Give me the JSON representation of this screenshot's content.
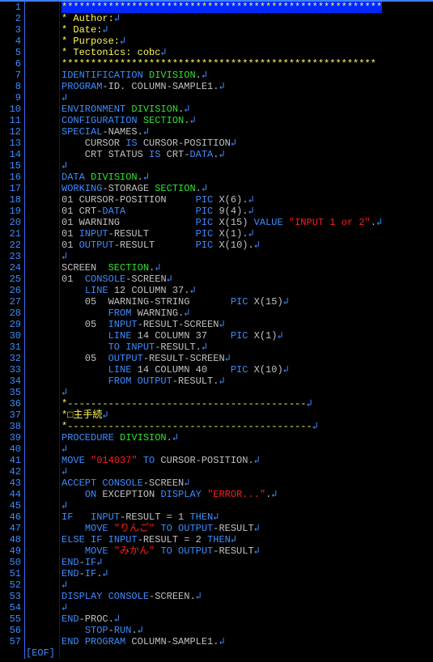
{
  "line_count": 57,
  "eof_label": "[EOF]",
  "eol": "↲",
  "lines": {
    "l1": {
      "stars_pre": "*",
      "stars": "******************************************************"
    },
    "l2": {
      "c": "* Author:"
    },
    "l3": {
      "c": "* Date:"
    },
    "l4": {
      "c": "* Purpose:"
    },
    "l5": {
      "c": "* Tectonics: cobc"
    },
    "l6": {
      "stars": "******************************************************"
    },
    "l7": {
      "a": "IDENTIFICATION ",
      "b": "DIVISION",
      "d": "."
    },
    "l8": {
      "a": "PROGRAM",
      "b": "-ID. COLUMN-SAMPLE1."
    },
    "l10": {
      "a": "ENVIRONMENT ",
      "b": "DIVISION",
      "d": "."
    },
    "l11": {
      "a": "CONFIGURATION ",
      "b": "SECTION",
      "d": "."
    },
    "l12": {
      "a": "SPECIAL",
      "b": "-NAMES."
    },
    "l13": {
      "a": "    CURSOR ",
      "b": "IS",
      "c": " CURSOR-POSITION"
    },
    "l14": {
      "a": "    CRT STATUS ",
      "b": "IS",
      "c": " CRT-",
      "d": "DATA",
      "e": "."
    },
    "l16": {
      "a": "DATA ",
      "b": "DIVISION",
      "d": "."
    },
    "l17": {
      "a": "WORKING",
      "b": "-STORAGE ",
      "c": "SECTION",
      "d": "."
    },
    "l18": {
      "a": "01 CURSOR-POSITION     ",
      "b": "PIC",
      "c": " X(6)."
    },
    "l19": {
      "a": "01 CRT-",
      "b": "DATA",
      "c": "            ",
      "d": "PIC",
      "e": " 9(4)."
    },
    "l20": {
      "a": "01 WARNING             ",
      "b": "PIC",
      "c": " X(15) ",
      "d": "VALUE",
      "e": " ",
      "f": "\"INPUT 1 or 2\"",
      "g": "."
    },
    "l21": {
      "a": "01 ",
      "b": "INPUT",
      "c": "-RESULT        ",
      "d": "PIC",
      "e": " X(1)."
    },
    "l22": {
      "a": "01 ",
      "b": "OUTPUT",
      "c": "-RESULT       ",
      "d": "PIC",
      "e": " X(10)."
    },
    "l24": {
      "a": "SCREEN  ",
      "b": "SECTION",
      "d": "."
    },
    "l25": {
      "a": "01  ",
      "b": "CONSOLE",
      "c": "-SCREEN"
    },
    "l26": {
      "a": "    ",
      "b": "LINE",
      "c": " 12 COLUMN 37."
    },
    "l27": {
      "a": "    05  WARNING-STRING       ",
      "b": "PIC",
      "c": " X(15)"
    },
    "l28": {
      "a": "        ",
      "b": "FROM",
      "c": " WARNING."
    },
    "l29": {
      "a": "    05  ",
      "b": "INPUT",
      "c": "-RESULT-SCREEN"
    },
    "l30": {
      "a": "        ",
      "b": "LINE",
      "c": " 14 COLUMN 37    ",
      "d": "PIC",
      "e": " X(1)"
    },
    "l31": {
      "a": "        ",
      "b": "TO INPUT",
      "c": "-RESULT."
    },
    "l32": {
      "a": "    05  ",
      "b": "OUTPUT",
      "c": "-RESULT-SCREEN"
    },
    "l33": {
      "a": "        ",
      "b": "LINE",
      "c": " 14 COLUMN 40    ",
      "d": "PIC",
      "e": " X(10)"
    },
    "l34": {
      "a": "        ",
      "b": "FROM OUTPUT",
      "c": "-RESULT."
    },
    "l36": {
      "a": "*",
      "b": "-----------------------------------------"
    },
    "l37": {
      "a": "*□主手続"
    },
    "l38": {
      "a": "*",
      "b": "------------------------------------------"
    },
    "l39": {
      "a": "PROCEDURE ",
      "b": "DIVISION",
      "d": "."
    },
    "l41": {
      "a": "MOVE ",
      "b": "\"014037\"",
      "c": " ",
      "d": "TO",
      "e": " CURSOR-POSITION."
    },
    "l43": {
      "a": "ACCEPT ",
      "b": "CONSOLE",
      "c": "-SCREEN"
    },
    "l44": {
      "a": "    ",
      "b": "ON",
      "c": " EXCEPTION ",
      "d": "DISPLAY",
      "e": " ",
      "f": "\"ERROR...\"",
      "g": "."
    },
    "l46": {
      "a": "IF",
      "b": "   ",
      "c": "INPUT",
      "d": "-RESULT = 1 ",
      "e": "THEN"
    },
    "l47": {
      "a": "    ",
      "b": "MOVE",
      "c": " ",
      "d": "\"りんご\"",
      "e": " ",
      "f": "TO OUTPUT",
      "g": "-RESULT"
    },
    "l48": {
      "a": "ELSE",
      "b": " ",
      "c": "IF",
      "d": " ",
      "e": "INPUT",
      "f": "-RESULT = 2 ",
      "g": "THEN"
    },
    "l49": {
      "a": "    ",
      "b": "MOVE",
      "c": " ",
      "d": "\"みかん\"",
      "e": " ",
      "f": "TO OUTPUT",
      "g": "-RESULT"
    },
    "l50": {
      "a": "END",
      "b": "-",
      "c": "IF"
    },
    "l51": {
      "a": "END",
      "b": "-",
      "c": "IF",
      "d": "."
    },
    "l53": {
      "a": "DISPLAY ",
      "b": "CONSOLE",
      "c": "-SCREEN."
    },
    "l55": {
      "a": "END",
      "b": "-PROC."
    },
    "l56": {
      "a": "    ",
      "b": "STOP",
      "c": "-",
      "d": "RUN",
      "e": "."
    },
    "l57": {
      "a": "END ",
      "b": "PROGRAM",
      "c": " COLUMN-SAMPLE1."
    }
  }
}
